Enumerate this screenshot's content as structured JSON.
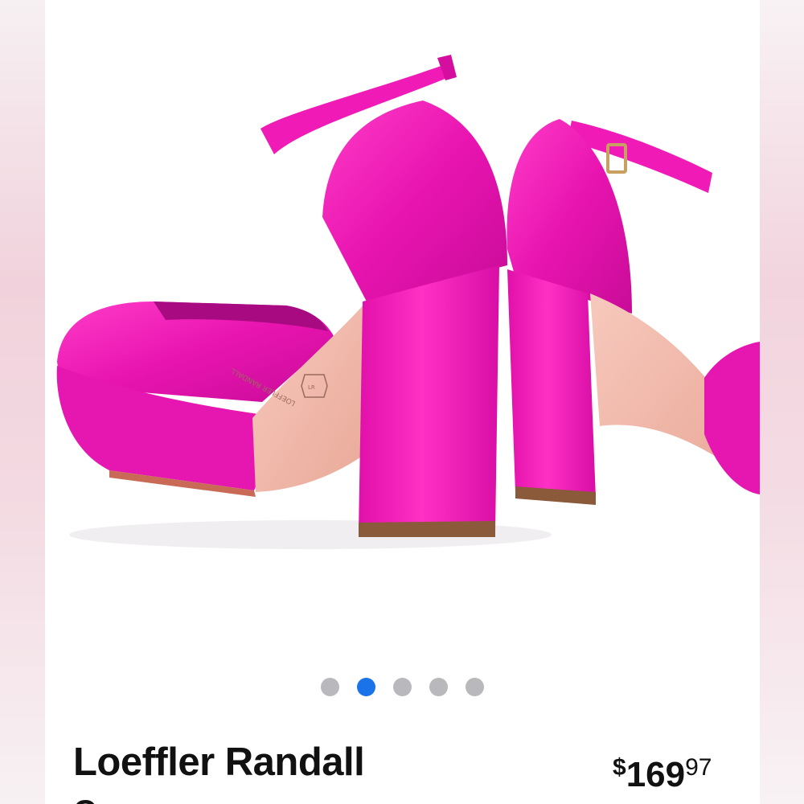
{
  "product": {
    "brand": "Loeffler Randall",
    "subtitle_fragment": "C   ·  ·   ·   ·  ·",
    "price": {
      "currency": "$",
      "whole": "169",
      "cents": "97"
    },
    "sole_stamp": "LOEFFLER RANDALL",
    "image_alt": "Pink satin platform heels with ankle strap",
    "colors": {
      "shoe": "#f018b4",
      "sole": "#f1b6a8",
      "active_dot": "#1a73e8",
      "inactive_dot": "#b9b9bd"
    }
  },
  "carousel": {
    "total": 5,
    "active_index": 1
  }
}
